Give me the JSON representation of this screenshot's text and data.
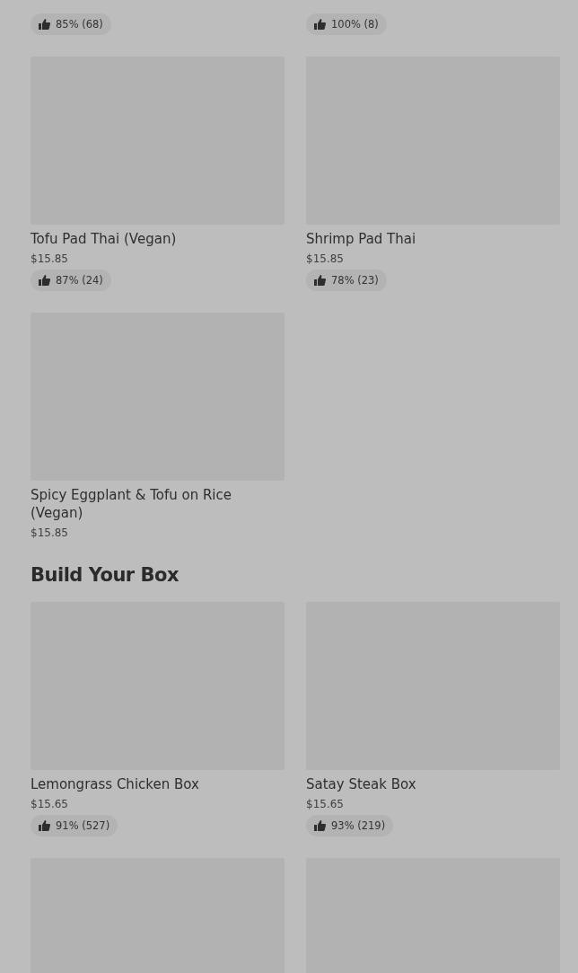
{
  "sections": [
    {
      "items": [
        {
          "rating": "85% (68)"
        },
        {
          "rating": "100% (8)"
        },
        {
          "name": "Tofu Pad Thai (Vegan)",
          "price": "$15.85",
          "rating": "87% (24)"
        },
        {
          "name": "Shrimp Pad Thai",
          "price": "$15.85",
          "rating": "78% (23)"
        },
        {
          "name": "Spicy Eggplant & Tofu on Rice (Vegan)",
          "price": "$15.85"
        }
      ]
    },
    {
      "title": "Build Your Box",
      "items": [
        {
          "name": "Lemongrass Chicken Box",
          "price": "$15.65",
          "rating": "91% (527)"
        },
        {
          "name": "Satay Steak Box",
          "price": "$15.65",
          "rating": "93% (219)"
        },
        {
          "kind": "picture"
        },
        {
          "kind": "picture"
        }
      ]
    }
  ]
}
